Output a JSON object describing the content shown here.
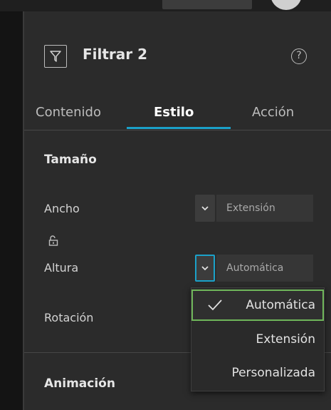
{
  "header": {
    "title": "Filtrar 2",
    "filter_icon": "filter-icon",
    "help_icon": "help-icon",
    "help_glyph": "?"
  },
  "tabs": [
    {
      "label": "Contenido",
      "active": false
    },
    {
      "label": "Estilo",
      "active": true
    },
    {
      "label": "Acción",
      "active": false
    }
  ],
  "size": {
    "section_title": "Tamaño",
    "width": {
      "label": "Ancho",
      "value": "Extensión"
    },
    "height": {
      "label": "Altura",
      "value": "Automática"
    },
    "rotation": {
      "label": "Rotación"
    }
  },
  "animation": {
    "section_title": "Animación"
  },
  "dropdown": {
    "options": [
      {
        "label": "Automática",
        "selected": true
      },
      {
        "label": "Extensión",
        "selected": false
      },
      {
        "label": "Personalizada",
        "selected": false
      }
    ]
  },
  "colors": {
    "accent": "#1ba1c9",
    "selected_outline": "#6fb65a",
    "panel_bg": "#2b2b2b"
  }
}
